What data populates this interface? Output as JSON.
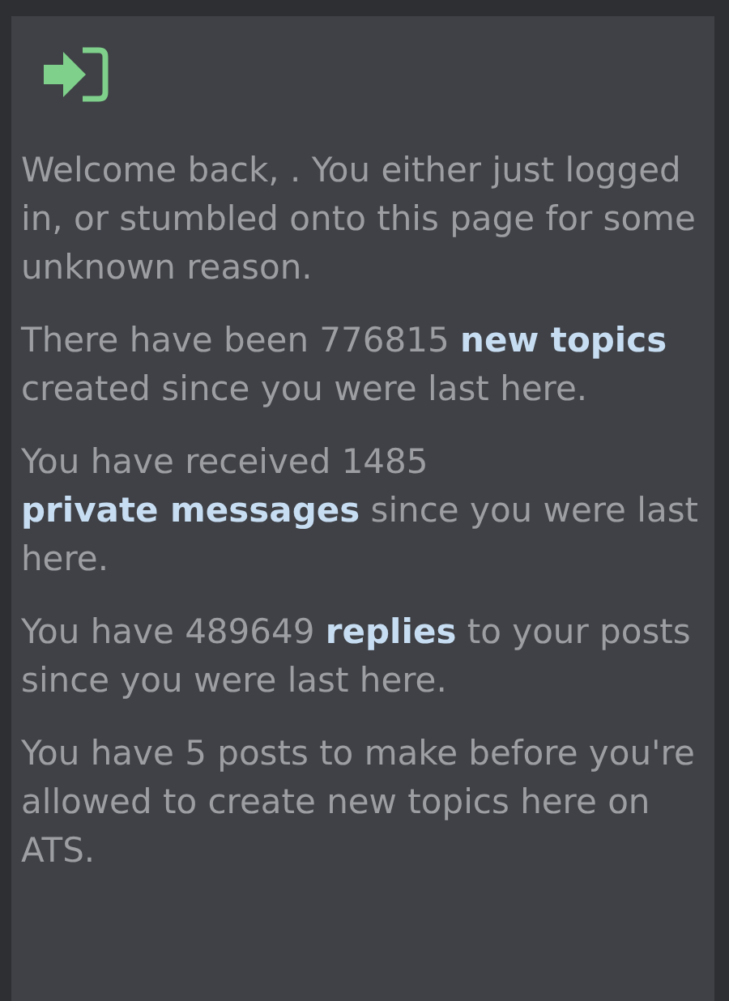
{
  "paragraphs": [
    {
      "segments": [
        {
          "kind": "text",
          "text": "Welcome back, . You either just logged in, or stumbled onto this page for some unknown reason."
        }
      ]
    },
    {
      "segments": [
        {
          "kind": "text",
          "text": "There have been 776815 "
        },
        {
          "kind": "link",
          "text": "new topics"
        },
        {
          "kind": "text",
          "text": " created since you were last here."
        }
      ]
    },
    {
      "segments": [
        {
          "kind": "text",
          "text": "You have received 1485 "
        },
        {
          "kind": "link",
          "text": "private messages"
        },
        {
          "kind": "text",
          "text": " since you were last here."
        }
      ]
    },
    {
      "segments": [
        {
          "kind": "text",
          "text": "You have 489649 "
        },
        {
          "kind": "link",
          "text": "replies"
        },
        {
          "kind": "text",
          "text": " to your posts since you were last here."
        }
      ]
    },
    {
      "segments": [
        {
          "kind": "text",
          "text": "You have 5 posts to make before you're allowed to create new topics here on ATS."
        }
      ]
    }
  ]
}
